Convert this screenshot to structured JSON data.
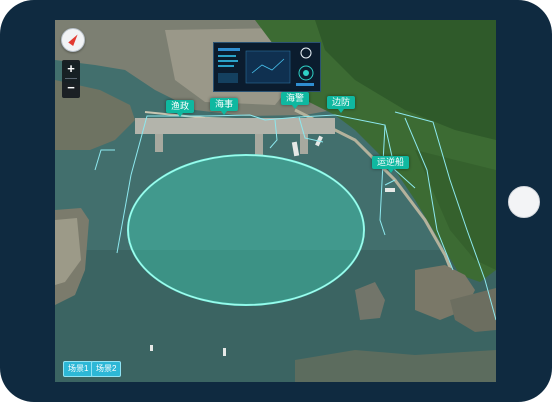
{
  "map": {
    "zoom_in_label": "+",
    "zoom_out_label": "−",
    "compass_icon": "compass-icon"
  },
  "markers": [
    {
      "label": "渔政"
    },
    {
      "label": "海事"
    },
    {
      "label": "海警"
    },
    {
      "label": "边防"
    },
    {
      "label": "运逆船"
    }
  ],
  "scenes": [
    {
      "label": "场景1"
    },
    {
      "label": "场景2"
    }
  ],
  "colors": {
    "device_frame": "#0f2a40",
    "marker": "#0fb8a0",
    "zone_fill": "#3ee8c9",
    "zone_stroke": "#7ff7e5",
    "scene_button": "#2db7d6"
  }
}
